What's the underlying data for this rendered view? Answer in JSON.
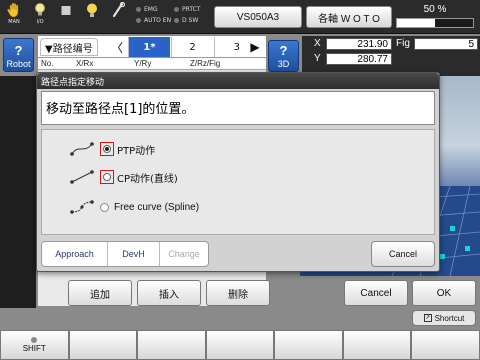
{
  "topbar": {
    "icons": [
      {
        "name": "hand-icon",
        "label": "MAN"
      },
      {
        "name": "lamp-icon",
        "label": "I/O"
      },
      {
        "name": "stop-icon",
        "label": ""
      },
      {
        "name": "bulb-icon",
        "label": ""
      },
      {
        "name": "wrench-icon",
        "label": ""
      }
    ],
    "indicators": [
      "EMG",
      "PRTCT",
      "AUTO EN",
      "D SW"
    ],
    "robot_button": "VS050A3",
    "axis_button": "各軸 W O T O",
    "speed_text": "50 %",
    "speed_fraction": 0.5
  },
  "left": {
    "robot_button": "Robot"
  },
  "path_panel": {
    "title": "▼路径编号",
    "prev_arrow": "〈",
    "next_arrow": "▶",
    "tabs": [
      "1*",
      "2",
      "3"
    ],
    "columns": [
      "No.",
      "X/Rx",
      "Y/Ry",
      "Z/Rz/Fig"
    ]
  },
  "right": {
    "view_button": "3D",
    "coords": [
      {
        "axis": "X",
        "value": "231.90"
      },
      {
        "axis": "Y",
        "value": "280.77"
      }
    ],
    "fig_label": "Fig",
    "fig_value": "5"
  },
  "dialog": {
    "title": "路径点指定移动",
    "message": "移动至路径点[1]的位置。",
    "options": [
      {
        "label": "PTP动作",
        "selected": true
      },
      {
        "label": "CP动作(直线)",
        "selected": false
      },
      {
        "label": "Free curve (Spline)",
        "selected": false
      }
    ],
    "segments": [
      "Approach",
      "DevH",
      "Change"
    ],
    "cancel": "Cancel"
  },
  "actions": {
    "add": "追加",
    "insert": "插入",
    "delete": "删除",
    "cancel": "Cancel",
    "ok": "OK"
  },
  "shortcut": "Shortcut",
  "fkeys": {
    "shift": "SHIFT"
  },
  "colors": {
    "accent": "#2a63c7",
    "highlight": "#dd1111",
    "panel_dark": "#2b2b2b"
  }
}
